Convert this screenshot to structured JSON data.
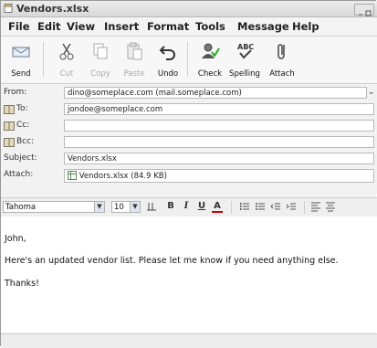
{
  "window": {
    "title": "Vendors.xlsx"
  },
  "menu": [
    "File",
    "Edit",
    "View",
    "Insert",
    "Format",
    "Tools",
    "Message",
    "Help"
  ],
  "toolbar": {
    "send": "Send",
    "cut": "Cut",
    "copy": "Copy",
    "paste": "Paste",
    "undo": "Undo",
    "check": "Check",
    "spelling": "Spelling",
    "attach": "Attach"
  },
  "header": {
    "from_label": "From:",
    "from_value": "dino@someplace.com   (mail.someplace.com)",
    "to_label": "To:",
    "to_value": "jondoe@someplace.com",
    "cc_label": "Cc:",
    "cc_value": "",
    "bcc_label": "Bcc:",
    "bcc_value": "",
    "subject_label": "Subject:",
    "subject_value": "Vendors.xlsx",
    "attach_label": "Attach:",
    "attachment": "Vendors.xlsx (84.9 KB)"
  },
  "format": {
    "font": "Tahoma",
    "size": "10",
    "bold": "B",
    "italic": "I",
    "underline": "U",
    "font_color": "A"
  },
  "message": {
    "greeting": "John,",
    "line1": "Here's an updated vendor list. Please let me know if you need anything else.",
    "signoff": "Thanks!"
  }
}
